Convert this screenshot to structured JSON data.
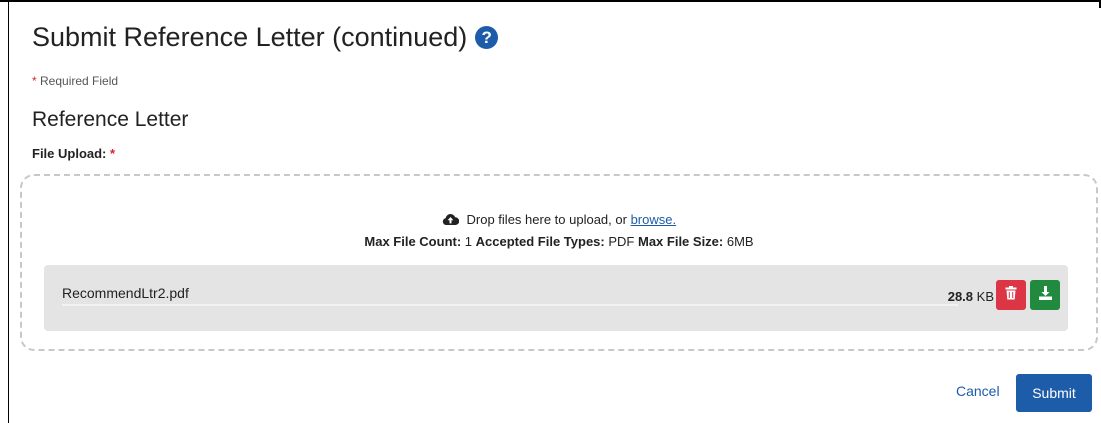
{
  "header": {
    "title": "Submit Reference Letter (continued)",
    "help_icon": "question-circle-icon"
  },
  "required_note": {
    "star": "*",
    "text": "Required Field"
  },
  "section": {
    "title": "Reference Letter"
  },
  "upload": {
    "label": "File Upload:",
    "required_star": "*",
    "drop_text": "Drop files here to upload, or",
    "browse_link": "browse.",
    "max_count_label": "Max File Count:",
    "max_count_value": "1",
    "types_label": "Accepted File Types:",
    "types_value": "PDF",
    "max_size_label": "Max File Size:",
    "max_size_value": "6MB",
    "file": {
      "name": "RecommendLtr2.pdf",
      "size_value": "28.8",
      "size_unit": "KB"
    }
  },
  "actions": {
    "cancel_label": "Cancel",
    "submit_label": "Submit"
  },
  "colors": {
    "primary": "#1d5ca8",
    "danger": "#dc3545",
    "success": "#218a3f",
    "required": "#d9232e"
  }
}
